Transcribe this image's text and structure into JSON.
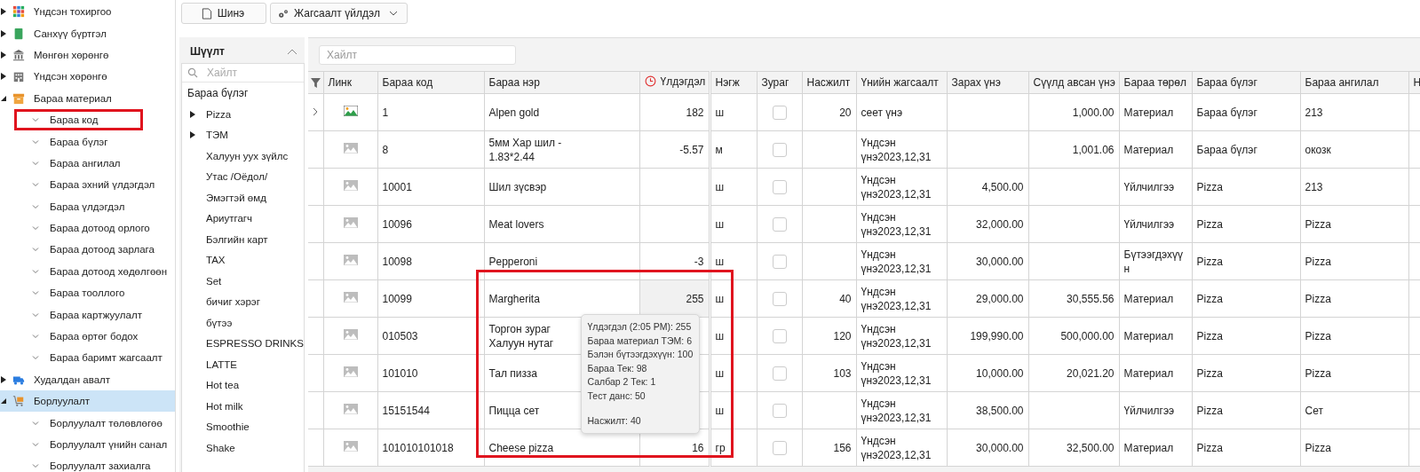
{
  "sidebar": {
    "items": [
      {
        "label": "Үндсэн тохиргоо",
        "expanded": false,
        "selected": false
      },
      {
        "label": "Санхүү бүртгэл",
        "expanded": false,
        "selected": false
      },
      {
        "label": "Мөнгөн хөрөнгө",
        "expanded": false,
        "selected": false
      },
      {
        "label": "Үндсэн хөрөнгө",
        "expanded": false,
        "selected": false
      },
      {
        "label": "Бараа материал",
        "expanded": true,
        "selected": false,
        "children": [
          {
            "label": "Бараа код",
            "selected": false,
            "marked": true
          },
          {
            "label": "Бараа бүлэг",
            "selected": false,
            "marked": false
          },
          {
            "label": "Бараа ангилал",
            "selected": false,
            "marked": false
          },
          {
            "label": "Бараа эхний үлдэгдэл",
            "selected": false,
            "marked": false
          },
          {
            "label": "Бараа үлдэгдэл",
            "selected": false,
            "marked": false
          },
          {
            "label": "Бараа дотоод орлого",
            "selected": false,
            "marked": false
          },
          {
            "label": "Бараа дотоод зарлага",
            "selected": false,
            "marked": false
          },
          {
            "label": "Бараа дотоод хөдөлгөөн",
            "selected": false,
            "marked": false
          },
          {
            "label": "Бараа тооллого",
            "selected": false,
            "marked": false
          },
          {
            "label": "Бараа картжуулалт",
            "selected": false,
            "marked": false
          },
          {
            "label": "Бараа өртөг бодох",
            "selected": false,
            "marked": false
          },
          {
            "label": "Бараа баримт жагсаалт",
            "selected": false,
            "marked": false
          }
        ]
      },
      {
        "label": "Худалдан авалт",
        "expanded": false,
        "selected": false
      },
      {
        "label": "Борлуулалт",
        "expanded": true,
        "selected": true,
        "children": [
          {
            "label": "Борлуулалт төлөвлөгөө",
            "selected": false,
            "marked": false
          },
          {
            "label": "Борлуулалт үнийн санал",
            "selected": false,
            "marked": false
          },
          {
            "label": "Борлуулалт захиалга",
            "selected": false,
            "marked": false
          }
        ]
      }
    ]
  },
  "toolbar": {
    "new_button": "Шинэ",
    "actions_button": "Жагсаалт үйлдэл"
  },
  "filter": {
    "title": "Шүүлт",
    "search": {
      "placeholder": "Хайлт"
    },
    "heading": "Бараа бүлэг",
    "items": [
      {
        "label": "Pizza",
        "kind": "group"
      },
      {
        "label": "ТЭМ",
        "kind": "group"
      },
      {
        "label": "Халуун уух зүйлс",
        "kind": "leaf"
      },
      {
        "label": "Утас /Оёдол/",
        "kind": "leaf"
      },
      {
        "label": "Эмэгтэй өмд",
        "kind": "leaf"
      },
      {
        "label": "Ариутгагч",
        "kind": "leaf"
      },
      {
        "label": "Бэлгийн карт",
        "kind": "leaf"
      },
      {
        "label": "TAX",
        "kind": "leaf"
      },
      {
        "label": "Set",
        "kind": "leaf"
      },
      {
        "label": "бичиг хэрэг",
        "kind": "leaf"
      },
      {
        "label": "бүтээ",
        "kind": "leaf"
      },
      {
        "label": "ESPRESSO DRINKS",
        "kind": "leaf"
      },
      {
        "label": "LATTE",
        "kind": "leaf"
      },
      {
        "label": "Hot tea",
        "kind": "leaf"
      },
      {
        "label": "Hot milk",
        "kind": "leaf"
      },
      {
        "label": "Smoothie",
        "kind": "leaf"
      },
      {
        "label": "Shake",
        "kind": "leaf"
      }
    ]
  },
  "table": {
    "search": {
      "placeholder": "Хайлт"
    },
    "annotation_frame": true,
    "columns": [
      "Линк",
      "Бараа код",
      "Бараа нэр",
      "Үлдэгдэл",
      "Нэгж",
      "Зураг",
      "Насжилт",
      "Үнийн жагсаалт",
      "Зарах үнэ",
      "Сүүлд авсан үнэ",
      "Бараа төрөл",
      "Бараа бүлэг",
      "Бараа ангилал",
      "Н"
    ],
    "rows": [
      {
        "expandable": true,
        "has_image": true,
        "code": "1",
        "name": "Alpen gold",
        "remainder": "182",
        "hovered": false,
        "unit": "ш",
        "checked": false,
        "age": "20",
        "price_list": "сеет үнэ",
        "sale_price": "",
        "last_cost": "1,000.00",
        "type": "Материал",
        "group": "Бараа бүлэг",
        "category": "213"
      },
      {
        "expandable": false,
        "has_image": false,
        "code": "8",
        "name": "5мм Хар шил - 1.83*2.44",
        "remainder": "-5.57",
        "hovered": false,
        "unit": "м",
        "checked": false,
        "age": "",
        "price_list": "Үндсэн үнэ2023,12,31",
        "sale_price": "",
        "last_cost": "1,001.06",
        "type": "Материал",
        "group": "Бараа бүлэг",
        "category": "окозк"
      },
      {
        "expandable": false,
        "has_image": false,
        "code": "10001",
        "name": "Шил зүсвэр",
        "remainder": "",
        "hovered": false,
        "unit": "ш",
        "checked": false,
        "age": "",
        "price_list": "Үндсэн үнэ2023,12,31",
        "sale_price": "4,500.00",
        "last_cost": "",
        "type": "Үйлчилгээ",
        "group": "Pizza",
        "category": "213"
      },
      {
        "expandable": false,
        "has_image": false,
        "code": "10096",
        "name": "Meat lovers",
        "remainder": "",
        "hovered": false,
        "unit": "ш",
        "checked": false,
        "age": "",
        "price_list": "Үндсэн үнэ2023,12,31",
        "sale_price": "32,000.00",
        "last_cost": "",
        "type": "Үйлчилгээ",
        "group": "Pizza",
        "category": "Pizza"
      },
      {
        "expandable": false,
        "has_image": false,
        "code": "10098",
        "name": "Pepperoni",
        "remainder": "-3",
        "hovered": false,
        "unit": "ш",
        "checked": false,
        "age": "",
        "price_list": "Үндсэн үнэ2023,12,31",
        "sale_price": "30,000.00",
        "last_cost": "",
        "type": "Бүтээгдэхүүн",
        "group": "Pizza",
        "category": "Pizza"
      },
      {
        "expandable": false,
        "has_image": false,
        "code": "10099",
        "name": "Margherita",
        "remainder": "255",
        "hovered": true,
        "unit": "ш",
        "checked": false,
        "age": "40",
        "price_list": "Үндсэн үнэ2023,12,31",
        "sale_price": "29,000.00",
        "last_cost": "30,555.56",
        "type": "Материал",
        "group": "Pizza",
        "category": "Pizza"
      },
      {
        "expandable": false,
        "has_image": false,
        "code": "010503",
        "name": "Торгон зураг Халуун нутаг",
        "remainder": "",
        "hovered": false,
        "unit": "ш",
        "checked": false,
        "age": "120",
        "price_list": "Үндсэн үнэ2023,12,31",
        "sale_price": "199,990.00",
        "last_cost": "500,000.00",
        "type": "Материал",
        "group": "Pizza",
        "category": "Pizza"
      },
      {
        "expandable": false,
        "has_image": false,
        "code": "101010",
        "name": "Тал пизза",
        "remainder": "",
        "hovered": false,
        "unit": "ш",
        "checked": false,
        "age": "103",
        "price_list": "Үндсэн үнэ2023,12,31",
        "sale_price": "10,000.00",
        "last_cost": "20,021.20",
        "type": "Материал",
        "group": "Pizza",
        "category": "Pizza"
      },
      {
        "expandable": false,
        "has_image": false,
        "code": "15151544",
        "name": "Пицца сет",
        "remainder": "",
        "hovered": false,
        "unit": "ш",
        "checked": false,
        "age": "",
        "price_list": "Үндсэн үнэ2023,12,31",
        "sale_price": "38,500.00",
        "last_cost": "",
        "type": "Үйлчилгээ",
        "group": "Pizza",
        "category": "Сет"
      },
      {
        "expandable": false,
        "has_image": false,
        "code": "101010101018",
        "name": "Cheese pizza",
        "remainder": "16",
        "hovered": false,
        "unit": "гр",
        "checked": false,
        "age": "156",
        "price_list": "Үндсэн үнэ2023,12,31",
        "sale_price": "30,000.00",
        "last_cost": "32,500.00",
        "type": "Материал",
        "group": "Pizza",
        "category": "Pizza"
      }
    ]
  },
  "tooltip": {
    "lines": [
      "Үлдэгдэл (2:05 PM): 255",
      "Бараа материал ТЭМ: 6",
      "Бэлэн бүтээгдэхүүн: 100",
      "Бараа Тек: 98",
      "Салбар 2 Тек: 1",
      "Тест данс: 50"
    ],
    "footer": "Насжилт: 40"
  }
}
